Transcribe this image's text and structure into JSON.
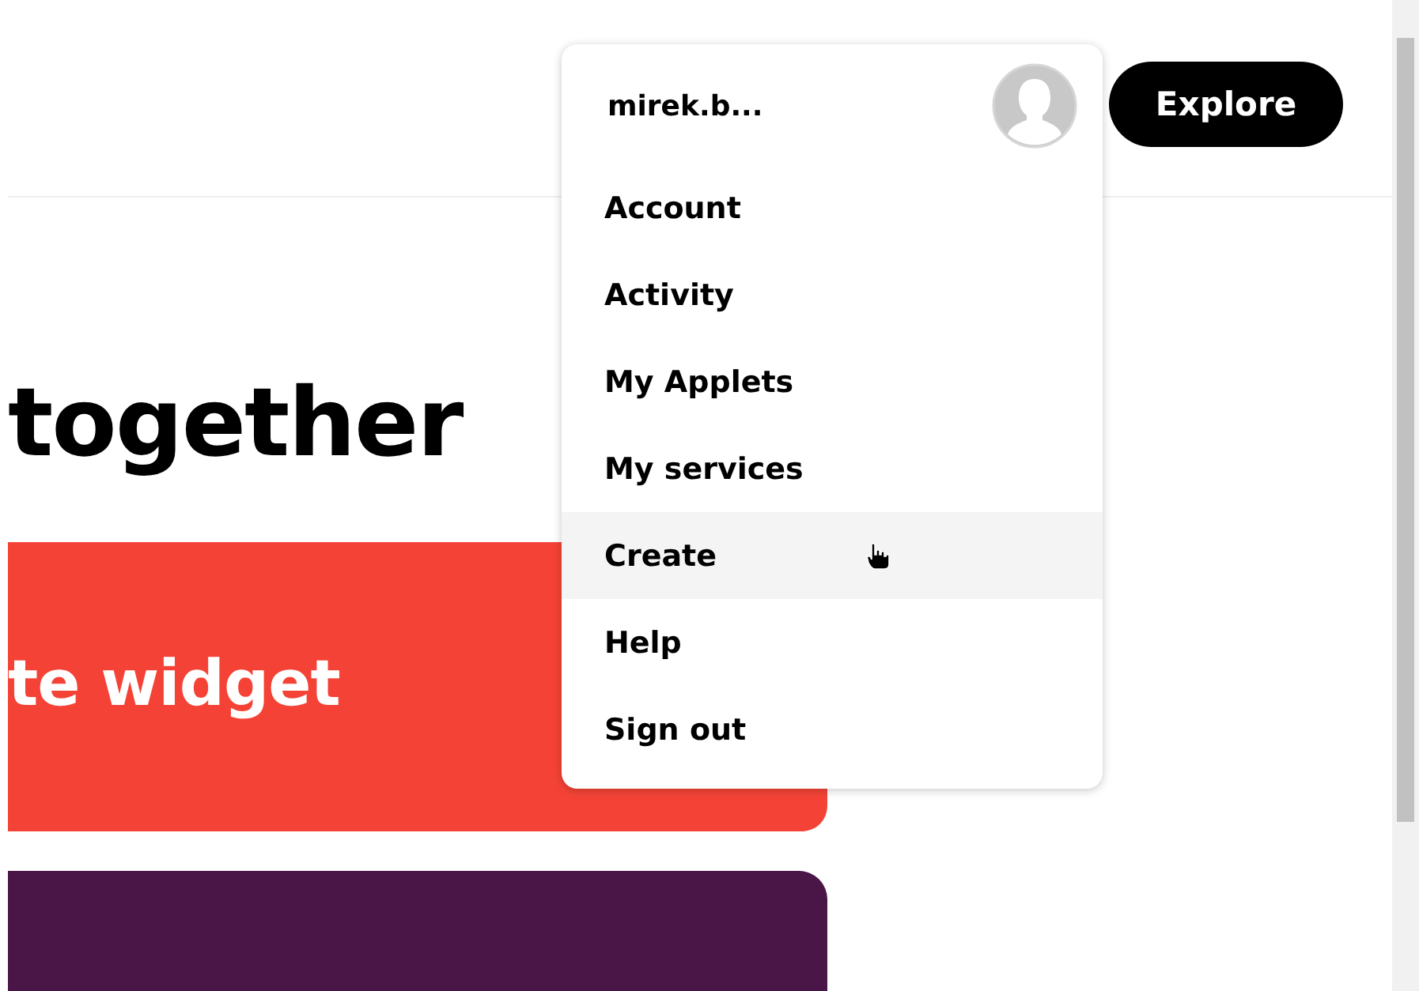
{
  "header": {
    "explore_button": "Explore"
  },
  "heading": "together",
  "cards": [
    {
      "title": "te widget",
      "color": "#f44336"
    },
    {
      "color": "#4a1648"
    }
  ],
  "user_menu": {
    "username": "mirek.b...",
    "items": [
      {
        "label": "Account",
        "hovered": false
      },
      {
        "label": "Activity",
        "hovered": false
      },
      {
        "label": "My Applets",
        "hovered": false
      },
      {
        "label": "My services",
        "hovered": false
      },
      {
        "label": "Create",
        "hovered": true
      },
      {
        "label": "Help",
        "hovered": false
      },
      {
        "label": "Sign out",
        "hovered": false
      }
    ]
  }
}
